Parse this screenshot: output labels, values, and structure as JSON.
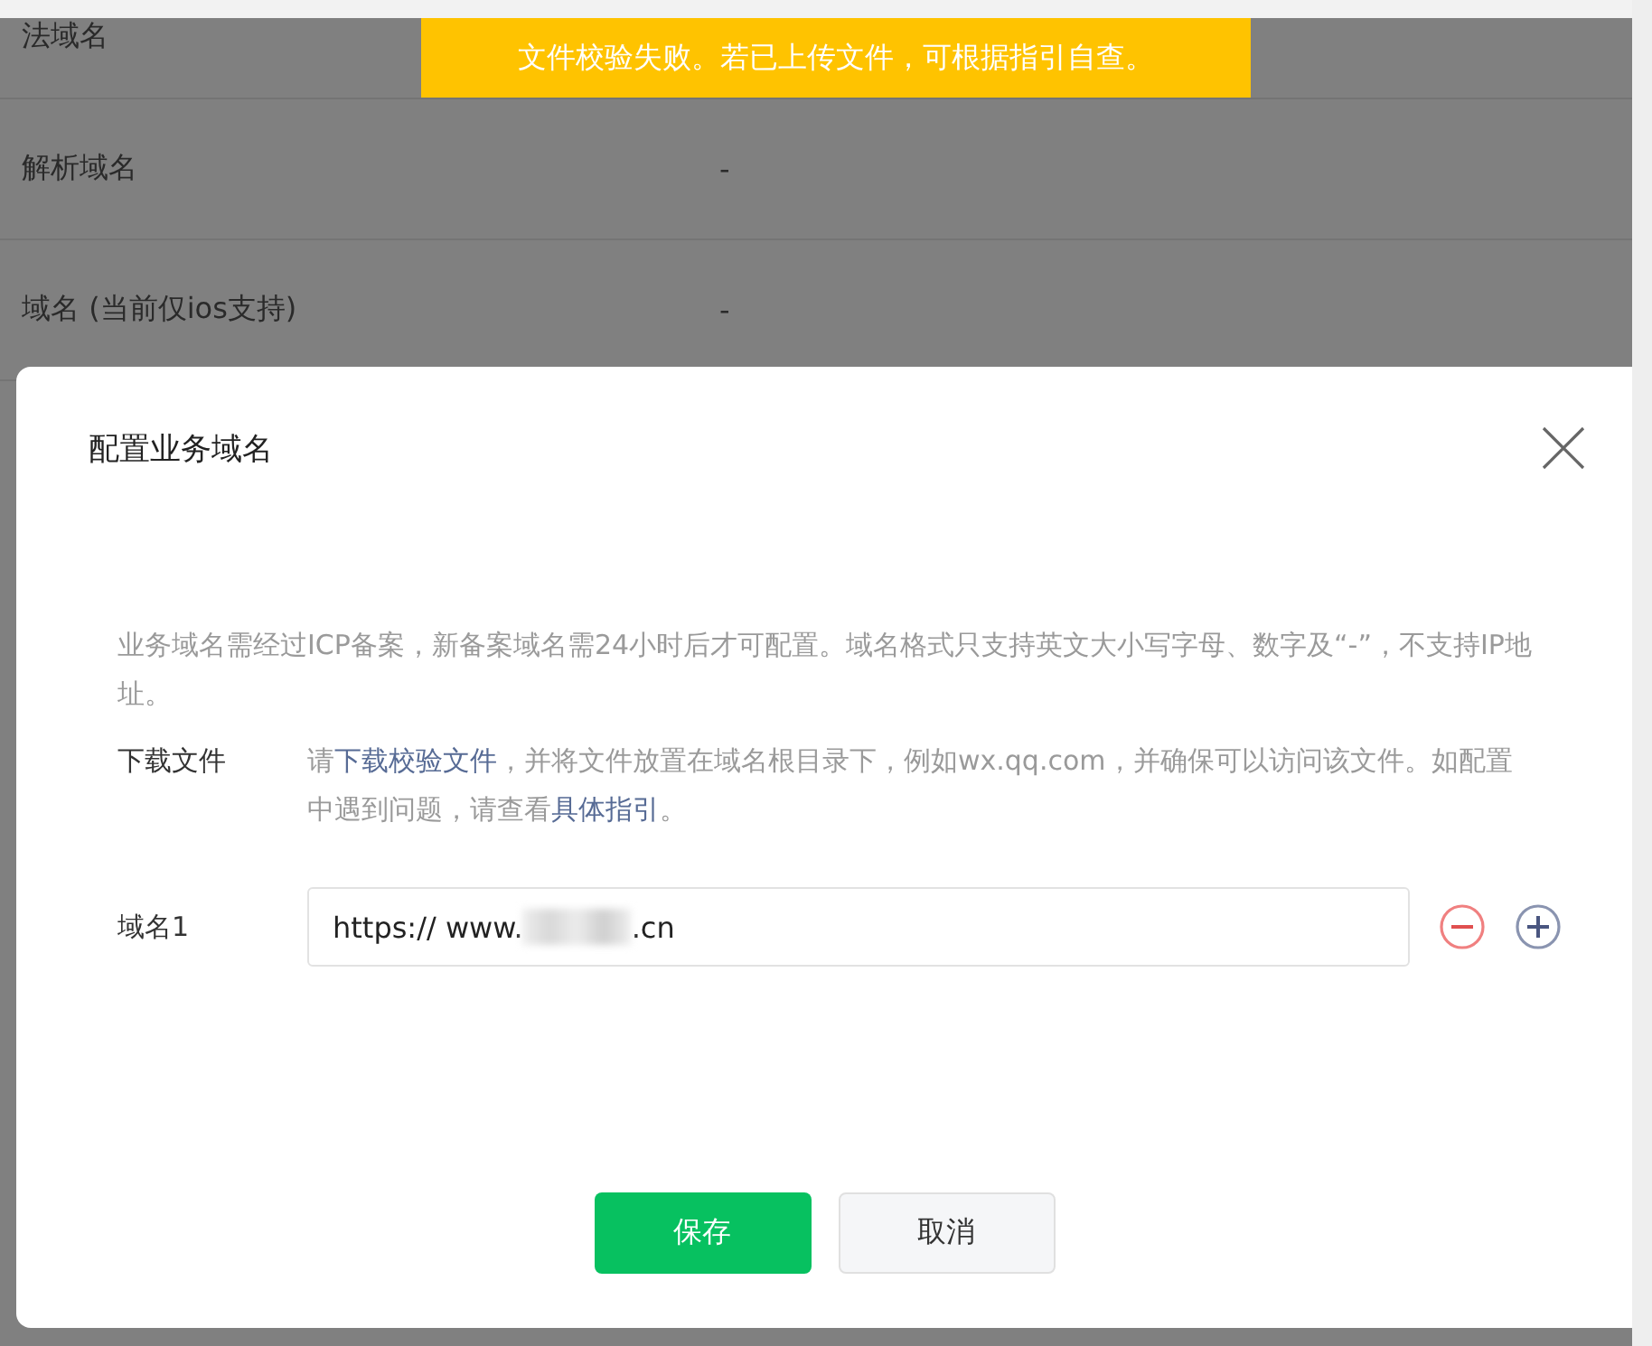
{
  "background_rows": [
    {
      "label": "法域名",
      "value": ""
    },
    {
      "label": "解析域名",
      "value": "-"
    },
    {
      "label": "域名 (当前仅ios支持)",
      "value": "-"
    }
  ],
  "toast": {
    "text": "文件校验失败。若已上传文件，可根据指引自查。"
  },
  "dialog": {
    "title": "配置业务域名",
    "description": "业务域名需经过ICP备案，新备案域名需24小时后才可配置。域名格式只支持英文大小写字母、数字及“-”，不支持IP地址。",
    "download": {
      "label": "下载文件",
      "parts": [
        {
          "text": "请",
          "link": false
        },
        {
          "text": "下载校验文件",
          "link": true
        },
        {
          "text": "，并将文件放置在域名根目录下，例如wx.qq.com，并确保可以访问该文件。如配置中遇到问题，请查看",
          "link": false
        },
        {
          "text": "具体指引",
          "link": true
        },
        {
          "text": "。",
          "link": false
        }
      ]
    },
    "domains": [
      {
        "label": "域名1",
        "value_start": "https:// www.",
        "value_end": ".cn",
        "redacted": true
      }
    ],
    "buttons": [
      {
        "label": "保存",
        "kind": "primary"
      },
      {
        "label": "取消",
        "kind": "secondary"
      }
    ]
  }
}
